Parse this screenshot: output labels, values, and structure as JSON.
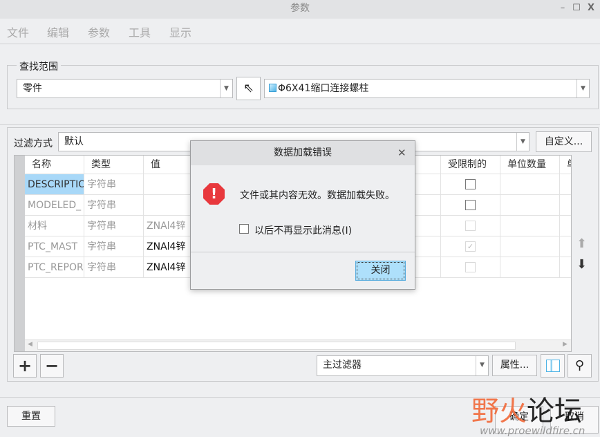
{
  "window": {
    "title": "参数"
  },
  "menu": [
    "文件",
    "编辑",
    "参数",
    "工具",
    "显示"
  ],
  "scope": {
    "label": "查找范围",
    "type_value": "零件",
    "model_value": "Φ6X41缩口连接螺柱"
  },
  "filter": {
    "label": "过滤方式",
    "value": "默认",
    "customize": "自定义..."
  },
  "table": {
    "headers": [
      "名称",
      "类型",
      "值",
      "受限制的",
      "单位数量",
      "单"
    ],
    "rows": [
      {
        "name": "DESCRIPTIO",
        "type": "字符串",
        "value": "",
        "restricted": "unchecked"
      },
      {
        "name": "MODELED_",
        "type": "字符串",
        "value": "",
        "restricted": "unchecked"
      },
      {
        "name": "材料",
        "type": "字符串",
        "value": "ZNAl4锌",
        "restricted": "disabled"
      },
      {
        "name": "PTC_MAST",
        "type": "字符串",
        "value": "ZNAl4锌",
        "restricted": "checked-disabled"
      },
      {
        "name": "PTC_REPOR",
        "type": "字符串",
        "value": "ZNAl4锌",
        "restricted": "disabled"
      }
    ]
  },
  "bottom": {
    "main_filter": "主过滤器",
    "properties": "属性...",
    "reset": "重置",
    "ok": "确定",
    "cancel": "取消"
  },
  "dialog": {
    "title": "数据加载错误",
    "message": "文件或其内容无效。数据加载失败。",
    "checkbox_label": "以后不再显示此消息(I)",
    "close": "关闭"
  },
  "watermark": {
    "text1": "野火",
    "text2": "论坛",
    "url": "www.proewildfire.cn"
  },
  "colors": {
    "selection": "#a8d8f8",
    "error": "#e8383d",
    "close_btn": "#aee0fb"
  }
}
